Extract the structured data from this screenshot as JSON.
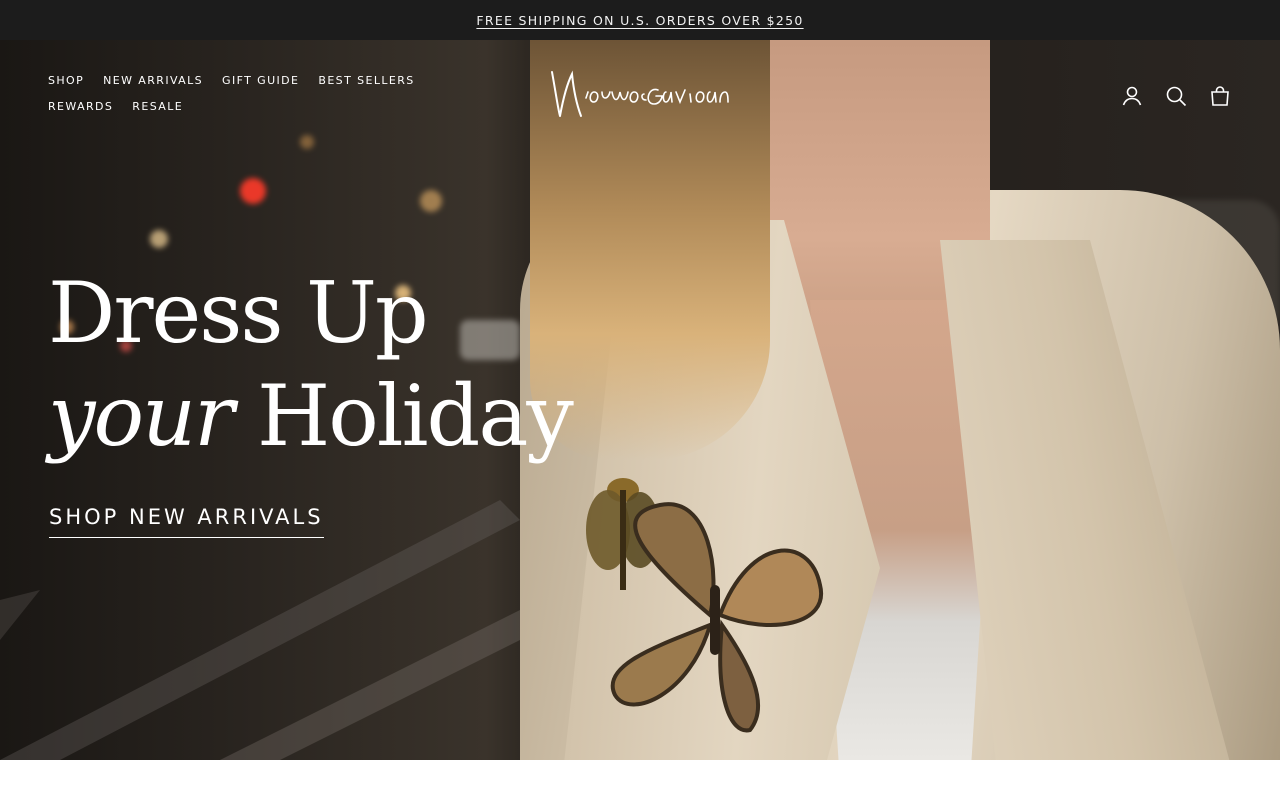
{
  "announcement": {
    "text": "FREE SHIPPING ON U.S. ORDERS OVER $250"
  },
  "header": {
    "logo_text": "Mignonne Gavigan",
    "nav": [
      "SHOP",
      "NEW ARRIVALS",
      "GIFT GUIDE",
      "BEST SELLERS",
      "REWARDS",
      "RESALE"
    ],
    "icons": [
      "account-icon",
      "search-icon",
      "bag-icon"
    ]
  },
  "hero": {
    "headline_line1": "Dress Up",
    "headline_line2_italic": "your",
    "headline_line2": "Holiday",
    "cta": "SHOP NEW ARRIVALS"
  },
  "colors": {
    "announcement_bg": "#1c1c1c",
    "text_on_hero": "#ffffff"
  }
}
